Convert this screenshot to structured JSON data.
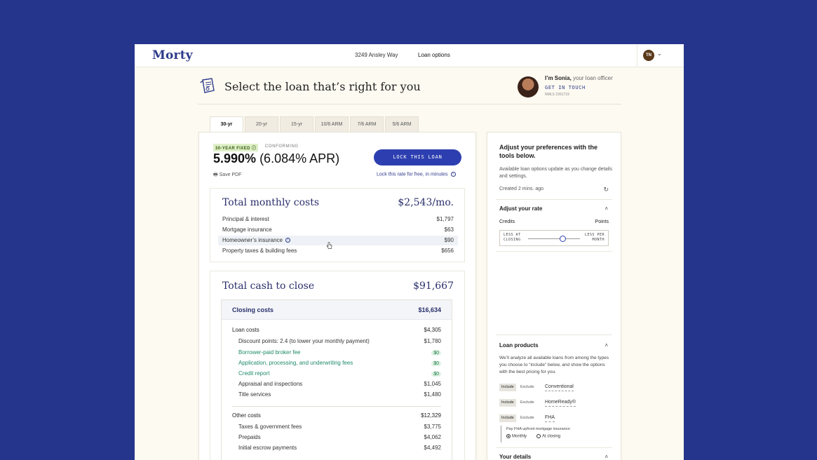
{
  "header": {
    "logo": "Morty",
    "address": "3249 Ansley Way",
    "nav_current": "Loan options",
    "avatar_initials": "TN"
  },
  "hero": {
    "title": "Select the loan that’s right for you",
    "officer_intro": "I’m Sonia,",
    "officer_role": " your loan officer",
    "contact_label": "GET IN TOUCH",
    "nmls": "NMLS 1561719"
  },
  "tabs": [
    "30-yr",
    "20-yr",
    "15-yr",
    "10/6 ARM",
    "7/6 ARM",
    "5/6 ARM"
  ],
  "quote": {
    "badge_type": "30-YEAR FIXED",
    "badge_class": "CONFORMING",
    "rate": "5.990%",
    "apr": " (6.084% APR)",
    "save_pdf": "Save PDF",
    "lock_button": "LOCK THIS LOAN",
    "lock_note": "Lock this rate for free, in minutes"
  },
  "monthly": {
    "title": "Total monthly costs",
    "total": "$2,543/mo.",
    "rows": [
      {
        "label": "Principal & interest",
        "value": "$1,797"
      },
      {
        "label": "Mortgage insurance",
        "value": "$63"
      },
      {
        "label": "Homeowner’s insurance",
        "value": "$90"
      },
      {
        "label": "Property taxes & building fees",
        "value": "$656"
      }
    ]
  },
  "cash": {
    "title": "Total cash to close",
    "total": "$91,667",
    "closing_label": "Closing costs",
    "closing_total": "$16,634",
    "loan_costs_label": "Loan costs",
    "loan_costs_total": "$4,305",
    "loan_items": [
      {
        "label": "Discount points: 2.4 (to lower your monthly payment)",
        "value": "$1,780"
      },
      {
        "label": "Borrower-paid broker fee",
        "value": "$0"
      },
      {
        "label": "Application, processing, and underwriting fees",
        "value": "$0"
      },
      {
        "label": "Credit report",
        "value": "$0"
      },
      {
        "label": "Appraisal and inspections",
        "value": "$1,045"
      },
      {
        "label": "Title services",
        "value": "$1,480"
      }
    ],
    "other_costs_label": "Other costs",
    "other_costs_total": "$12,329",
    "other_items": [
      {
        "label": "Taxes & government fees",
        "value": "$3,775"
      },
      {
        "label": "Prepaids",
        "value": "$4,062"
      },
      {
        "label": "Initial escrow payments",
        "value": "$4,492"
      }
    ]
  },
  "prefs": {
    "title": "Adjust your preferences with the tools below.",
    "desc": "Available loan options update as you change details and settings.",
    "created": "Created 2 mins. ago",
    "rate_section": "Adjust your rate",
    "credits": "Credits",
    "points": "Points",
    "slider_left_1": "LESS AT",
    "slider_left_2": "CLOSING",
    "slider_right_1": "LESS PER",
    "slider_right_2": "MONTH",
    "slider_value": 0.68,
    "products_section": "Loan products",
    "products_desc": "We’ll analyze all available loans from among the types you choose to “include” below, and show the options with the best pricing for you.",
    "include": "Include",
    "exclude": "Exclude",
    "products": [
      "Conventional",
      "HomeReady®",
      "FHA"
    ],
    "fha_question": "Pay FHA upfront mortgage insurance:",
    "fha_monthly": "Monthly",
    "fha_closing": "At closing",
    "details_section": "Your details"
  }
}
